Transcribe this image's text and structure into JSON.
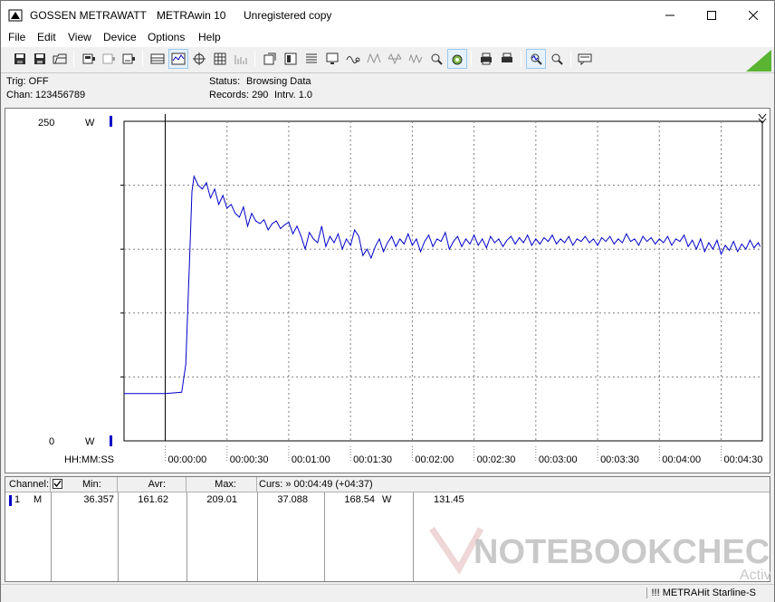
{
  "window": {
    "title_company": "GOSSEN METRAWATT",
    "title_app": "METRAwin 10",
    "title_license": "Unregistered copy"
  },
  "menu": [
    "File",
    "Edit",
    "View",
    "Device",
    "Options",
    "Help"
  ],
  "toolbar_icons": [
    "save-icon",
    "save-as-icon",
    "open-icon",
    "device-icon",
    "device-disabled-icon",
    "device-read-icon",
    "table-view-icon",
    "chart-view-icon",
    "cursor-icon",
    "grid-icon",
    "bars-icon",
    "export-icon",
    "print-table-icon",
    "list-icon",
    "monitor-icon",
    "signal-icon",
    "scale-a-icon",
    "scale-b-icon",
    "scale-c-icon",
    "zoom-icon",
    "target-icon",
    "print-icon",
    "print-preview-icon",
    "zoom-wave-icon",
    "zoom-reset-icon",
    "comment-icon"
  ],
  "status": {
    "trig_label": "Trig: OFF",
    "chan_label": "Chan:",
    "chan_value": "123456789",
    "status_label": "Status:",
    "status_value": "Browsing Data",
    "records_label": "Records: 290",
    "interval_label": "Intrv. 1.0"
  },
  "chart_data": {
    "type": "line",
    "y_top_label": "250",
    "y_bottom_label": "0",
    "y_unit": "W",
    "ylim": [
      0,
      250
    ],
    "x_axis_label": "HH:MM:SS",
    "x_ticks": [
      "00:00:00",
      "00:00:30",
      "00:01:00",
      "00:01:30",
      "00:02:00",
      "00:02:30",
      "00:03:00",
      "00:03:30",
      "00:04:00",
      "00:04:30"
    ],
    "x_range_seconds": [
      -20,
      290
    ],
    "grid": true,
    "color": "#0000c8",
    "series": [
      {
        "points": [
          [
            -20,
            37
          ],
          [
            0,
            37
          ],
          [
            8,
            38
          ],
          [
            10,
            60
          ],
          [
            12,
            150
          ],
          [
            13,
            195
          ],
          [
            14,
            207
          ],
          [
            16,
            200
          ],
          [
            18,
            197
          ],
          [
            20,
            202
          ],
          [
            22,
            190
          ],
          [
            24,
            197
          ],
          [
            26,
            185
          ],
          [
            28,
            192
          ],
          [
            30,
            182
          ],
          [
            32,
            185
          ],
          [
            34,
            178
          ],
          [
            36,
            175
          ],
          [
            38,
            183
          ],
          [
            40,
            168
          ],
          [
            42,
            178
          ],
          [
            44,
            172
          ],
          [
            46,
            170
          ],
          [
            48,
            173
          ],
          [
            50,
            165
          ],
          [
            52,
            170
          ],
          [
            54,
            172
          ],
          [
            56,
            166
          ],
          [
            58,
            169
          ],
          [
            60,
            171
          ],
          [
            62,
            162
          ],
          [
            64,
            168
          ],
          [
            66,
            160
          ],
          [
            68,
            150
          ],
          [
            70,
            163
          ],
          [
            72,
            158
          ],
          [
            74,
            155
          ],
          [
            76,
            168
          ],
          [
            78,
            152
          ],
          [
            80,
            160
          ],
          [
            82,
            155
          ],
          [
            84,
            162
          ],
          [
            86,
            150
          ],
          [
            88,
            158
          ],
          [
            90,
            153
          ],
          [
            92,
            165
          ],
          [
            94,
            160
          ],
          [
            96,
            145
          ],
          [
            98,
            150
          ],
          [
            100,
            143
          ],
          [
            102,
            152
          ],
          [
            104,
            158
          ],
          [
            106,
            148
          ],
          [
            108,
            155
          ],
          [
            110,
            160
          ],
          [
            112,
            152
          ],
          [
            114,
            158
          ],
          [
            116,
            154
          ],
          [
            118,
            162
          ],
          [
            120,
            153
          ],
          [
            122,
            158
          ],
          [
            124,
            148
          ],
          [
            126,
            156
          ],
          [
            128,
            161
          ],
          [
            130,
            152
          ],
          [
            132,
            158
          ],
          [
            134,
            156
          ],
          [
            136,
            163
          ],
          [
            138,
            150
          ],
          [
            140,
            156
          ],
          [
            142,
            160
          ],
          [
            144,
            152
          ],
          [
            146,
            158
          ],
          [
            148,
            154
          ],
          [
            150,
            161
          ],
          [
            152,
            153
          ],
          [
            154,
            158
          ],
          [
            156,
            151
          ],
          [
            158,
            160
          ],
          [
            160,
            155
          ],
          [
            162,
            158
          ],
          [
            164,
            152
          ],
          [
            166,
            157
          ],
          [
            168,
            160
          ],
          [
            170,
            154
          ],
          [
            172,
            159
          ],
          [
            174,
            155
          ],
          [
            176,
            161
          ],
          [
            178,
            153
          ],
          [
            180,
            158
          ],
          [
            182,
            154
          ],
          [
            184,
            159
          ],
          [
            186,
            156
          ],
          [
            188,
            161
          ],
          [
            190,
            154
          ],
          [
            192,
            158
          ],
          [
            194,
            155
          ],
          [
            196,
            160
          ],
          [
            198,
            153
          ],
          [
            200,
            158
          ],
          [
            202,
            156
          ],
          [
            204,
            160
          ],
          [
            206,
            155
          ],
          [
            208,
            158
          ],
          [
            210,
            153
          ],
          [
            212,
            159
          ],
          [
            214,
            156
          ],
          [
            216,
            160
          ],
          [
            218,
            154
          ],
          [
            220,
            158
          ],
          [
            222,
            155
          ],
          [
            224,
            162
          ],
          [
            226,
            156
          ],
          [
            228,
            158
          ],
          [
            230,
            153
          ],
          [
            232,
            160
          ],
          [
            234,
            156
          ],
          [
            236,
            159
          ],
          [
            238,
            154
          ],
          [
            240,
            158
          ],
          [
            242,
            155
          ],
          [
            244,
            160
          ],
          [
            246,
            153
          ],
          [
            248,
            158
          ],
          [
            250,
            156
          ],
          [
            252,
            161
          ],
          [
            254,
            152
          ],
          [
            256,
            157
          ],
          [
            258,
            150
          ],
          [
            260,
            158
          ],
          [
            262,
            148
          ],
          [
            264,
            155
          ],
          [
            266,
            150
          ],
          [
            268,
            157
          ],
          [
            270,
            146
          ],
          [
            272,
            153
          ],
          [
            274,
            149
          ],
          [
            276,
            156
          ],
          [
            278,
            148
          ],
          [
            280,
            154
          ],
          [
            282,
            150
          ],
          [
            284,
            157
          ],
          [
            286,
            151
          ],
          [
            288,
            155
          ],
          [
            289,
            152
          ]
        ]
      }
    ]
  },
  "table": {
    "headers": {
      "channel": "Channel:",
      "min": "Min:",
      "avr": "Avr:",
      "max": "Max:",
      "curs": "Curs: » 00:04:49 (+04:37)"
    },
    "row": {
      "chan_num": "1",
      "chan_mode": "M",
      "min": "36.357",
      "avr": "161.62",
      "max": "209.01",
      "cursor_val": "37.088",
      "cursor_val2": "168.54",
      "unit": "W",
      "cursor_val3": "131.45"
    }
  },
  "statusbar": {
    "device": "!!! METRAHit Starline-S"
  },
  "watermark": {
    "text": "NOTEBOOKCHECK",
    "sub": "Activ"
  }
}
